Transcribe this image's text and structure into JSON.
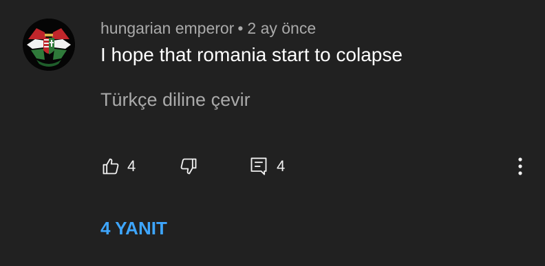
{
  "comment": {
    "author": "hungarian emperor",
    "separator": "•",
    "time": "2 ay önce",
    "text": "I hope that romania start to colapse",
    "translate_label": "Türkçe diline çevir"
  },
  "actions": {
    "like_icon": "thumb-up-outline",
    "like_count": "4",
    "dislike_icon": "thumb-down-outline",
    "reply_icon": "comment-reply-outline",
    "reply_count": "4",
    "more_icon": "vertical-ellipsis"
  },
  "replies": {
    "label": "4 YANIT"
  },
  "colors": {
    "background": "#212121",
    "primary_text": "#ffffff",
    "secondary_text": "#aaaaaa",
    "link": "#3ea6ff"
  }
}
